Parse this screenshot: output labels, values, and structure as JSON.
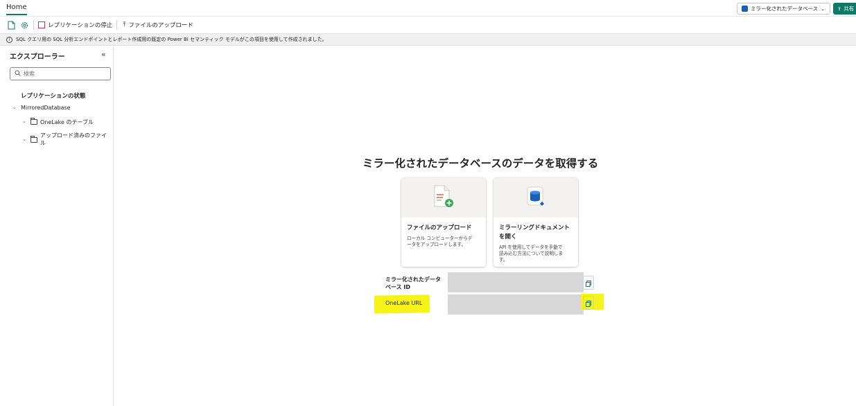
{
  "topbar": {
    "home_tab": "Home",
    "mirror_dropdown": "ミラー化されたデータベース",
    "share_button": "共有"
  },
  "toolbar": {
    "stop_replication": "レプリケーションの停止",
    "upload_files": "ファイルのアップロード"
  },
  "info_bar": {
    "message": "SQL クエリ用の SQL 分析エンドポイントとレポート作成用の既定の Power BI セマンティック モデルがこの項目を使用して作成されました。"
  },
  "explorer": {
    "title": "エクスプローラー",
    "search_placeholder": "検索",
    "replication_status": "レプリケーションの状態",
    "tree": {
      "root": "MirroredDatabase",
      "tables": "OneLake のテーブル",
      "uploaded_files_line1": "アップロード済みのファイ",
      "uploaded_files_line2": "ル"
    }
  },
  "main": {
    "title": "ミラー化されたデータベースのデータを取得する",
    "cards": [
      {
        "title": "ファイルのアップロード",
        "desc_line1": "ローカル コンピューターからデ",
        "desc_line2": "ータをアップロードします。",
        "icon": "upload-file-icon"
      },
      {
        "title_line1": "ミラーリングドキュメント",
        "title_line2": "を開く",
        "desc_line1": "API を使用してデータを手動で",
        "desc_line2": "読み込む方法について説明しま",
        "desc_line3": "す。",
        "icon": "mirrored-database-icon"
      }
    ],
    "fields": {
      "mirror_id_label_line1": "ミラー化されたデータ",
      "mirror_id_label_line2": "ベース ID",
      "onelake_url_label": "OneLake URL"
    }
  },
  "colors": {
    "accent": "#117865",
    "highlight": "#f6f31a",
    "stop_red": "#c4314b"
  }
}
